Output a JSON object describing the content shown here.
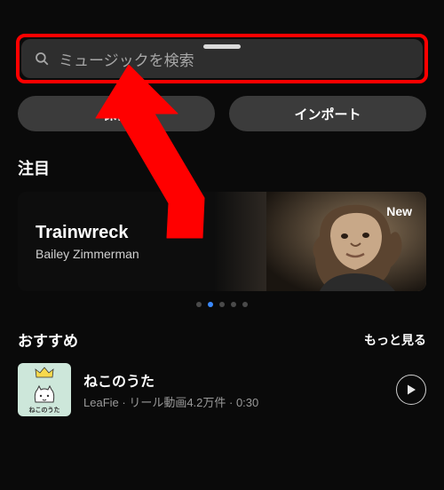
{
  "search": {
    "placeholder": "ミュージックを検索"
  },
  "buttons": {
    "saved": "保存",
    "import": "インポート"
  },
  "featured": {
    "heading": "注目",
    "card": {
      "title": "Trainwreck",
      "artist": "Bailey Zimmerman",
      "badge": "New"
    },
    "page_count": 5,
    "active_index": 1
  },
  "recommended": {
    "heading": "おすすめ",
    "more": "もっと見る",
    "tracks": [
      {
        "title": "ねこのうた",
        "artist": "LeaFie",
        "reels": "リール動画4.2万件",
        "duration": "0:30",
        "album_caption": "ねこのうた"
      }
    ]
  }
}
